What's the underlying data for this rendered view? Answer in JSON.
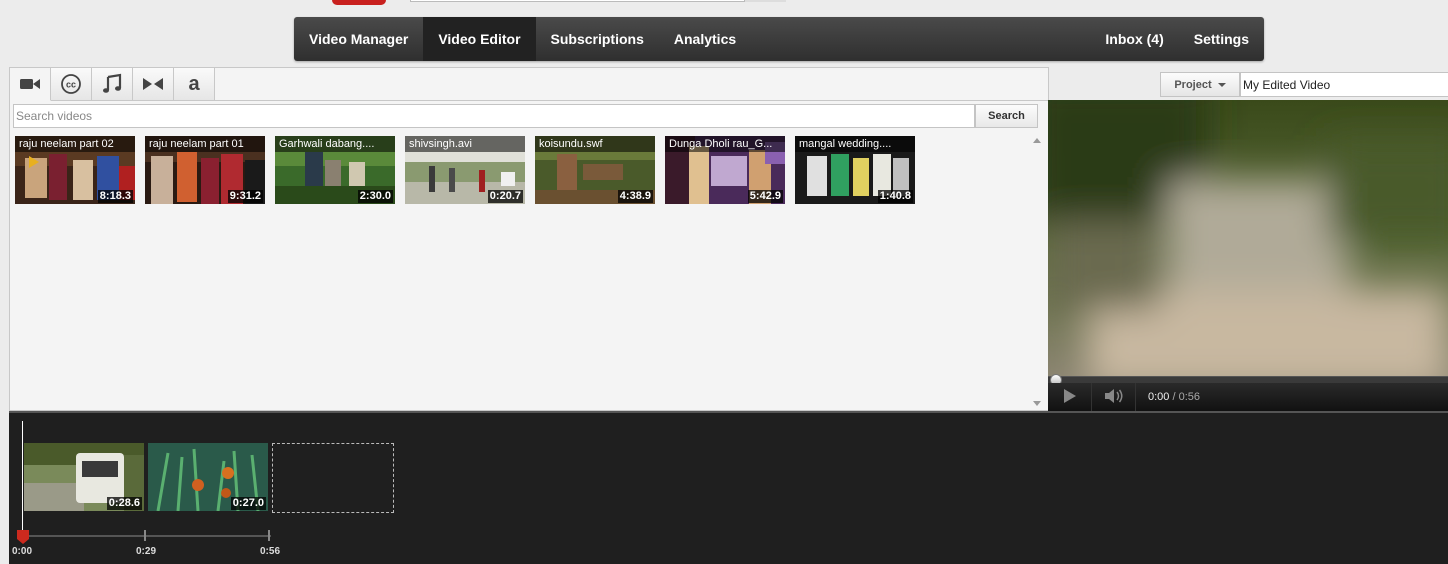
{
  "nav": {
    "items": [
      "Video Manager",
      "Video Editor",
      "Subscriptions",
      "Analytics"
    ],
    "inbox": "Inbox (4)",
    "settings": "Settings",
    "active": "Video Editor"
  },
  "tabs": [
    {
      "icon": "video-camera-icon"
    },
    {
      "icon": "cc-icon"
    },
    {
      "icon": "music-note-icon"
    },
    {
      "icon": "transitions-icon"
    },
    {
      "icon": "text-a-icon"
    }
  ],
  "search": {
    "placeholder": "Search videos",
    "button": "Search"
  },
  "videos": [
    {
      "title": "raju neelam part 02",
      "duration": "8:18.3"
    },
    {
      "title": "raju neelam part 01",
      "duration": "9:31.2"
    },
    {
      "title": "Garhwali dabang....",
      "duration": "2:30.0"
    },
    {
      "title": "shivsingh.avi",
      "duration": "0:20.7"
    },
    {
      "title": "koisundu.swf",
      "duration": "4:38.9"
    },
    {
      "title": "Dunga Dholi rau_G...",
      "duration": "5:42.9"
    },
    {
      "title": "mangal wedding....",
      "duration": "1:40.8"
    }
  ],
  "project": {
    "label": "Project",
    "name": "My Edited Video"
  },
  "player": {
    "current": "0:00",
    "separator": " / ",
    "duration": "0:56"
  },
  "timeline": {
    "clips": [
      {
        "duration": "0:28.6"
      },
      {
        "duration": "0:27.0"
      }
    ],
    "ruler": [
      "0:00",
      "0:29",
      "0:56"
    ]
  },
  "colors": {
    "navbar": "#3a3a3a",
    "marker": "#cc2a1e"
  }
}
